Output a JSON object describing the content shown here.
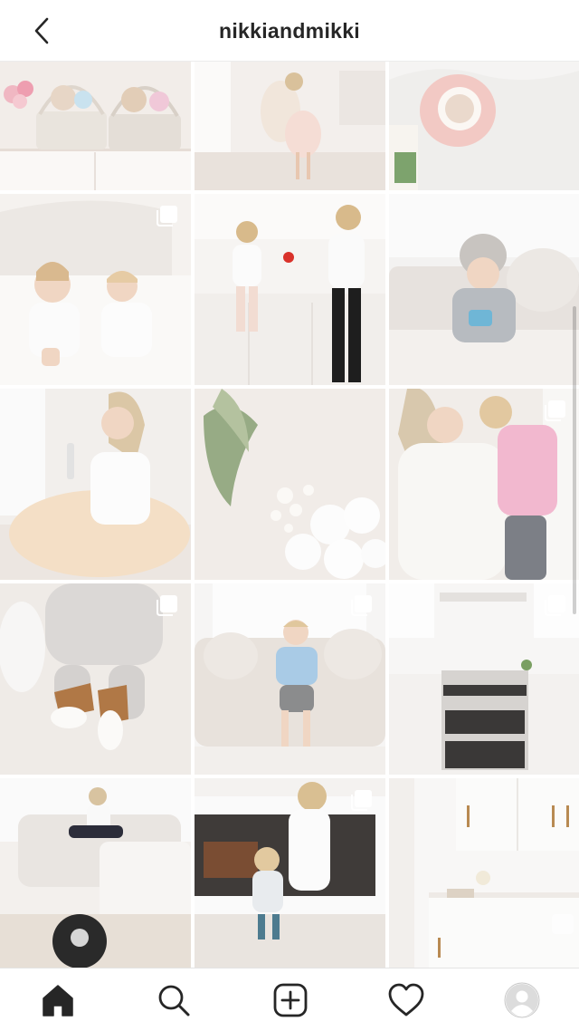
{
  "header": {
    "username": "nikkiandmikki",
    "back_icon": "chevron-left-icon"
  },
  "grid": {
    "columns": 3,
    "rows": 5,
    "posts": [
      {
        "name": "post-easter-baskets",
        "multi": false
      },
      {
        "name": "post-girls-tutu-dance",
        "multi": false
      },
      {
        "name": "post-coffee-cup",
        "multi": false
      },
      {
        "name": "post-kids-on-bed",
        "multi": true
      },
      {
        "name": "post-kitchen-apple",
        "multi": false
      },
      {
        "name": "post-boy-on-sofa",
        "multi": false
      },
      {
        "name": "post-mom-white-tutu",
        "multi": false
      },
      {
        "name": "post-white-roses-flatlay",
        "multi": false
      },
      {
        "name": "post-mom-hugging-daughter",
        "multi": true
      },
      {
        "name": "post-baby-shoes",
        "multi": true
      },
      {
        "name": "post-toddler-on-couch",
        "multi": true
      },
      {
        "name": "post-white-kitchen-stove",
        "multi": true
      },
      {
        "name": "post-living-room-robot-vacuum",
        "multi": false
      },
      {
        "name": "post-kids-by-fireplace",
        "multi": true
      },
      {
        "name": "post-kitchen-cabinets",
        "multi": false
      }
    ]
  },
  "tabbar": {
    "tabs": [
      {
        "name": "tab-home",
        "icon": "home-icon",
        "active": true
      },
      {
        "name": "tab-search",
        "icon": "search-icon",
        "active": false
      },
      {
        "name": "tab-new-post",
        "icon": "add-post-icon",
        "active": false
      },
      {
        "name": "tab-activity",
        "icon": "heart-icon",
        "active": false
      },
      {
        "name": "tab-profile",
        "icon": "avatar-icon",
        "active": false
      }
    ]
  },
  "colors": {
    "text": "#262626",
    "separator": "#ececec",
    "photo_base": "#efe9e4"
  }
}
